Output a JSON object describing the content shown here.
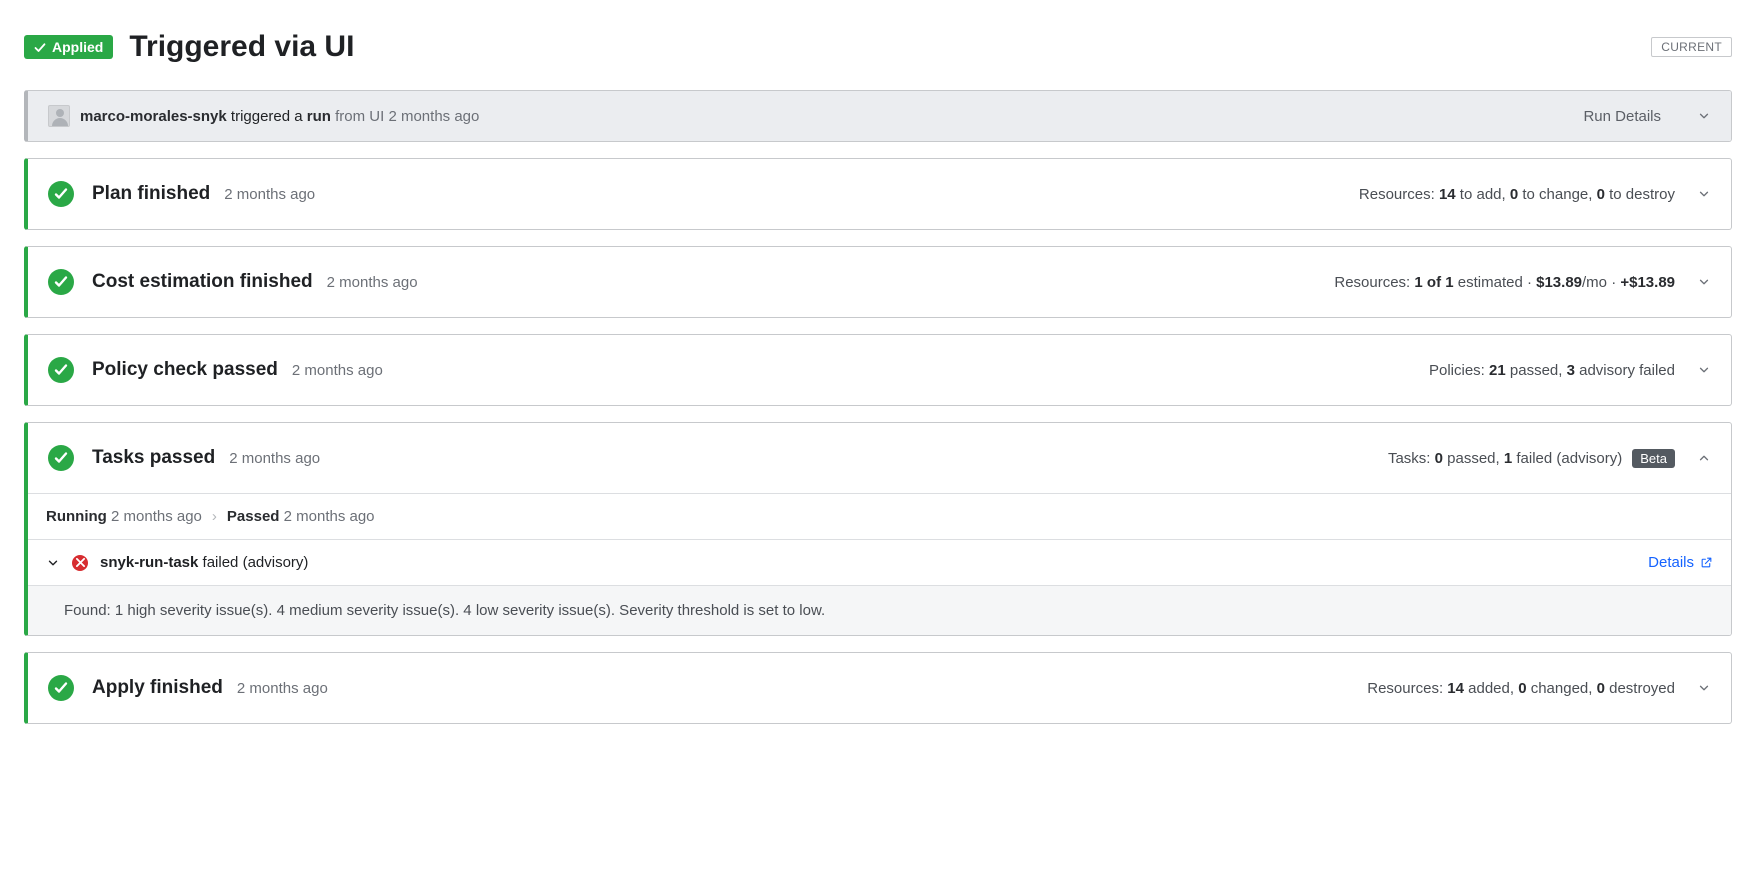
{
  "header": {
    "applied_label": "Applied",
    "title": "Triggered via UI",
    "current_label": "CURRENT"
  },
  "run_details": {
    "user": "marco-morales-snyk",
    "action_prefix": " triggered a ",
    "action_bold": "run",
    "action_suffix": " from UI 2 months ago",
    "button_label": "Run Details"
  },
  "stages": {
    "plan": {
      "title": "Plan finished",
      "time": "2 months ago",
      "summary_prefix": "Resources: ",
      "add_n": "14",
      "add_txt": " to add, ",
      "change_n": "0",
      "change_txt": " to change, ",
      "destroy_n": "0",
      "destroy_txt": " to destroy"
    },
    "cost": {
      "title": "Cost estimation finished",
      "time": "2 months ago",
      "summary_prefix": "Resources: ",
      "est_n": "1 of 1",
      "est_txt": " estimated · ",
      "price": "$13.89",
      "price_txt": "/mo · ",
      "delta": "+$13.89"
    },
    "policy": {
      "title": "Policy check passed",
      "time": "2 months ago",
      "summary_prefix": "Policies: ",
      "pass_n": "21",
      "pass_txt": " passed, ",
      "adv_n": "3",
      "adv_txt": " advisory failed"
    },
    "tasks": {
      "title": "Tasks passed",
      "time": "2 months ago",
      "summary_prefix": "Tasks: ",
      "pass_n": "0",
      "pass_txt": " passed, ",
      "fail_n": "1",
      "fail_txt": " failed (advisory)",
      "beta_label": "Beta",
      "timeline": {
        "running_label": "Running",
        "running_time": "2 months ago",
        "passed_label": "Passed",
        "passed_time": "2 months ago"
      },
      "item": {
        "name": "snyk-run-task",
        "status_text": " failed (advisory)",
        "details_label": "Details",
        "message": "Found: 1 high severity issue(s). 4 medium severity issue(s). 4 low severity issue(s). Severity threshold is set to low."
      }
    },
    "apply": {
      "title": "Apply finished",
      "time": "2 months ago",
      "summary_prefix": "Resources: ",
      "add_n": "14",
      "add_txt": " added, ",
      "change_n": "0",
      "change_txt": " changed, ",
      "destroy_n": "0",
      "destroy_txt": " destroyed"
    }
  }
}
